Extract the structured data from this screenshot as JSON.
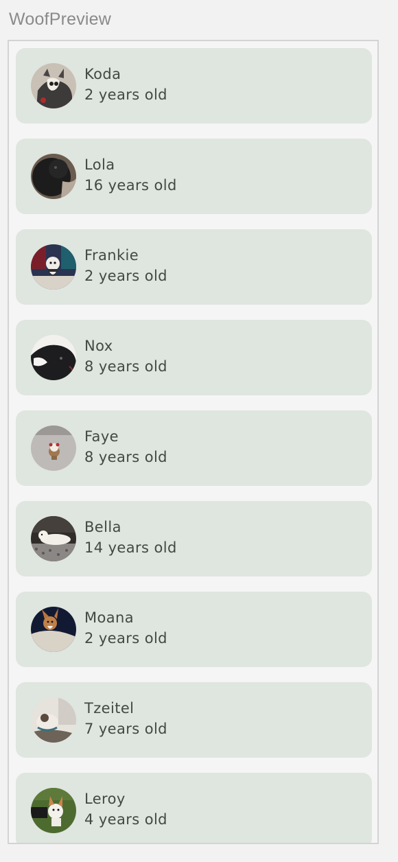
{
  "preview": {
    "title": "WoofPreview"
  },
  "dogs": [
    {
      "name": "Koda",
      "age": "2 years old",
      "photo": "koda-photo"
    },
    {
      "name": "Lola",
      "age": "16 years old",
      "photo": "lola-photo"
    },
    {
      "name": "Frankie",
      "age": "2 years old",
      "photo": "frankie-photo"
    },
    {
      "name": "Nox",
      "age": "8 years old",
      "photo": "nox-photo"
    },
    {
      "name": "Faye",
      "age": "8 years old",
      "photo": "faye-photo"
    },
    {
      "name": "Bella",
      "age": "14 years old",
      "photo": "bella-photo"
    },
    {
      "name": "Moana",
      "age": "2 years old",
      "photo": "moana-photo"
    },
    {
      "name": "Tzeitel",
      "age": "7 years old",
      "photo": "tzeitel-photo"
    },
    {
      "name": "Leroy",
      "age": "4 years old",
      "photo": "leroy-photo"
    }
  ],
  "colors": {
    "card_background": "#dfe5df",
    "text": "#424942",
    "title": "#8a8a8a"
  }
}
